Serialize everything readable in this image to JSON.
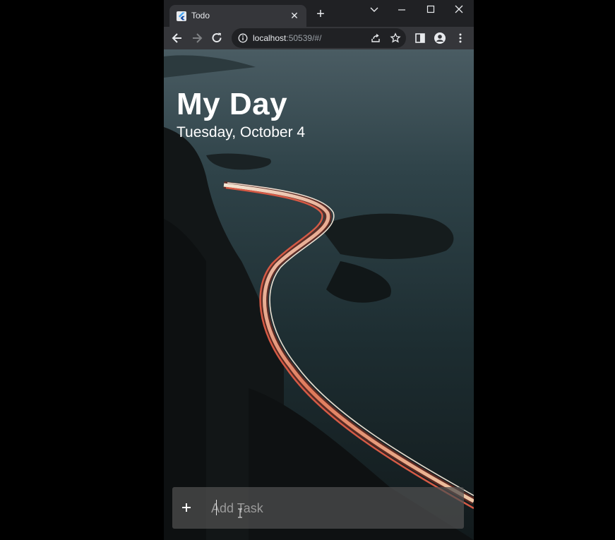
{
  "browser": {
    "tab": {
      "title": "Todo",
      "favicon": "flutter-icon"
    },
    "url_host": "localhost",
    "url_rest": ":50539/#/"
  },
  "app": {
    "title": "My Day",
    "date": "Tuesday, October 4",
    "add_task_placeholder": "Add Task"
  },
  "colors": {
    "chrome_dark": "#202124",
    "toolbar": "#35363a",
    "text": "#ffffff"
  }
}
